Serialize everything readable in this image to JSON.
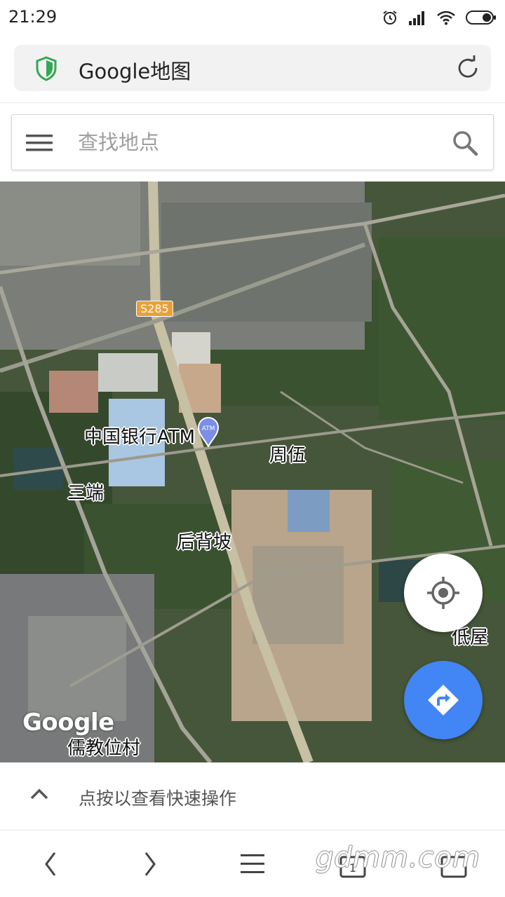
{
  "status": {
    "time": "21:29",
    "icons": [
      "alarm-icon",
      "signal-icon",
      "wifi-icon",
      "battery-icon"
    ]
  },
  "browser": {
    "url_title": "Google地图",
    "secure_color": "#34a853"
  },
  "search": {
    "placeholder": "查找地点"
  },
  "map": {
    "road_badge": "S285",
    "atm_label": "中国银行ATM",
    "places": [
      "周伍",
      "三端",
      "后背坡",
      "低屋",
      "儒教位村"
    ],
    "logo": "Google",
    "accent": "#4285f4"
  },
  "quick_actions": {
    "label": "点按以查看快速操作"
  },
  "nav": {
    "watermark": "gdmm.com",
    "buttons": [
      "back-icon",
      "forward-icon",
      "menu-icon",
      "tabs-icon",
      "home-icon"
    ]
  }
}
